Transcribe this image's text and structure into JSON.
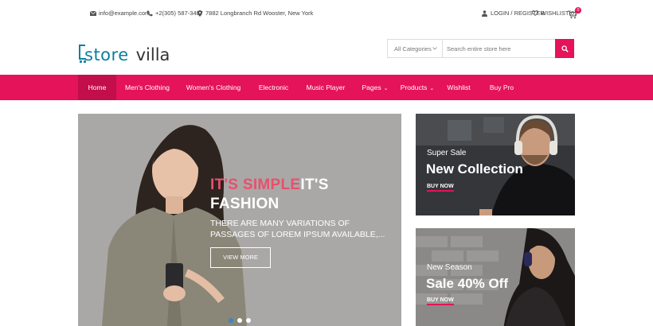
{
  "topbar": {
    "email": "info@example.com",
    "phone": "+2(305) 587-3407",
    "address": "7882 Longbranch Rd Wooster, New York",
    "login": "LOGIN / REGISTER",
    "wishlist": "WISHLIST(0)",
    "cart_count": "0"
  },
  "header": {
    "logo_part1": "store",
    "logo_part2": "villa",
    "search": {
      "category": "All Categories",
      "placeholder": "Search entire store here"
    }
  },
  "nav": {
    "items": [
      {
        "label": "Home",
        "active": true
      },
      {
        "label": "Men's Clothing"
      },
      {
        "label": "Women's Clothing"
      },
      {
        "label": "Electronic"
      },
      {
        "label": "Music Player"
      },
      {
        "label": "Pages",
        "dropdown": true
      },
      {
        "label": "Products",
        "dropdown": true
      },
      {
        "label": "Wishlist"
      },
      {
        "label": "Buy Pro"
      }
    ]
  },
  "hero": {
    "title_highlight": "IT'S SIMPLE",
    "title_rest": "IT'S",
    "title_line2": "FASHION",
    "subtitle": "THERE ARE MANY VARIATIONS OF PASSAGES OF LOREM IPSUM AVAILABLE,...",
    "button": "VIEW MORE",
    "slides": 3,
    "active_slide": 1
  },
  "banners": [
    {
      "kicker": "Super Sale",
      "title": "New Collection",
      "link": "BUY NOW"
    },
    {
      "kicker": "New Season",
      "title": "Sale 40% Off",
      "link": "BUY NOW"
    }
  ],
  "colors": {
    "brand": "#e4135a",
    "logo": "#0d7ea0",
    "hero_highlight": "#e8506e"
  }
}
